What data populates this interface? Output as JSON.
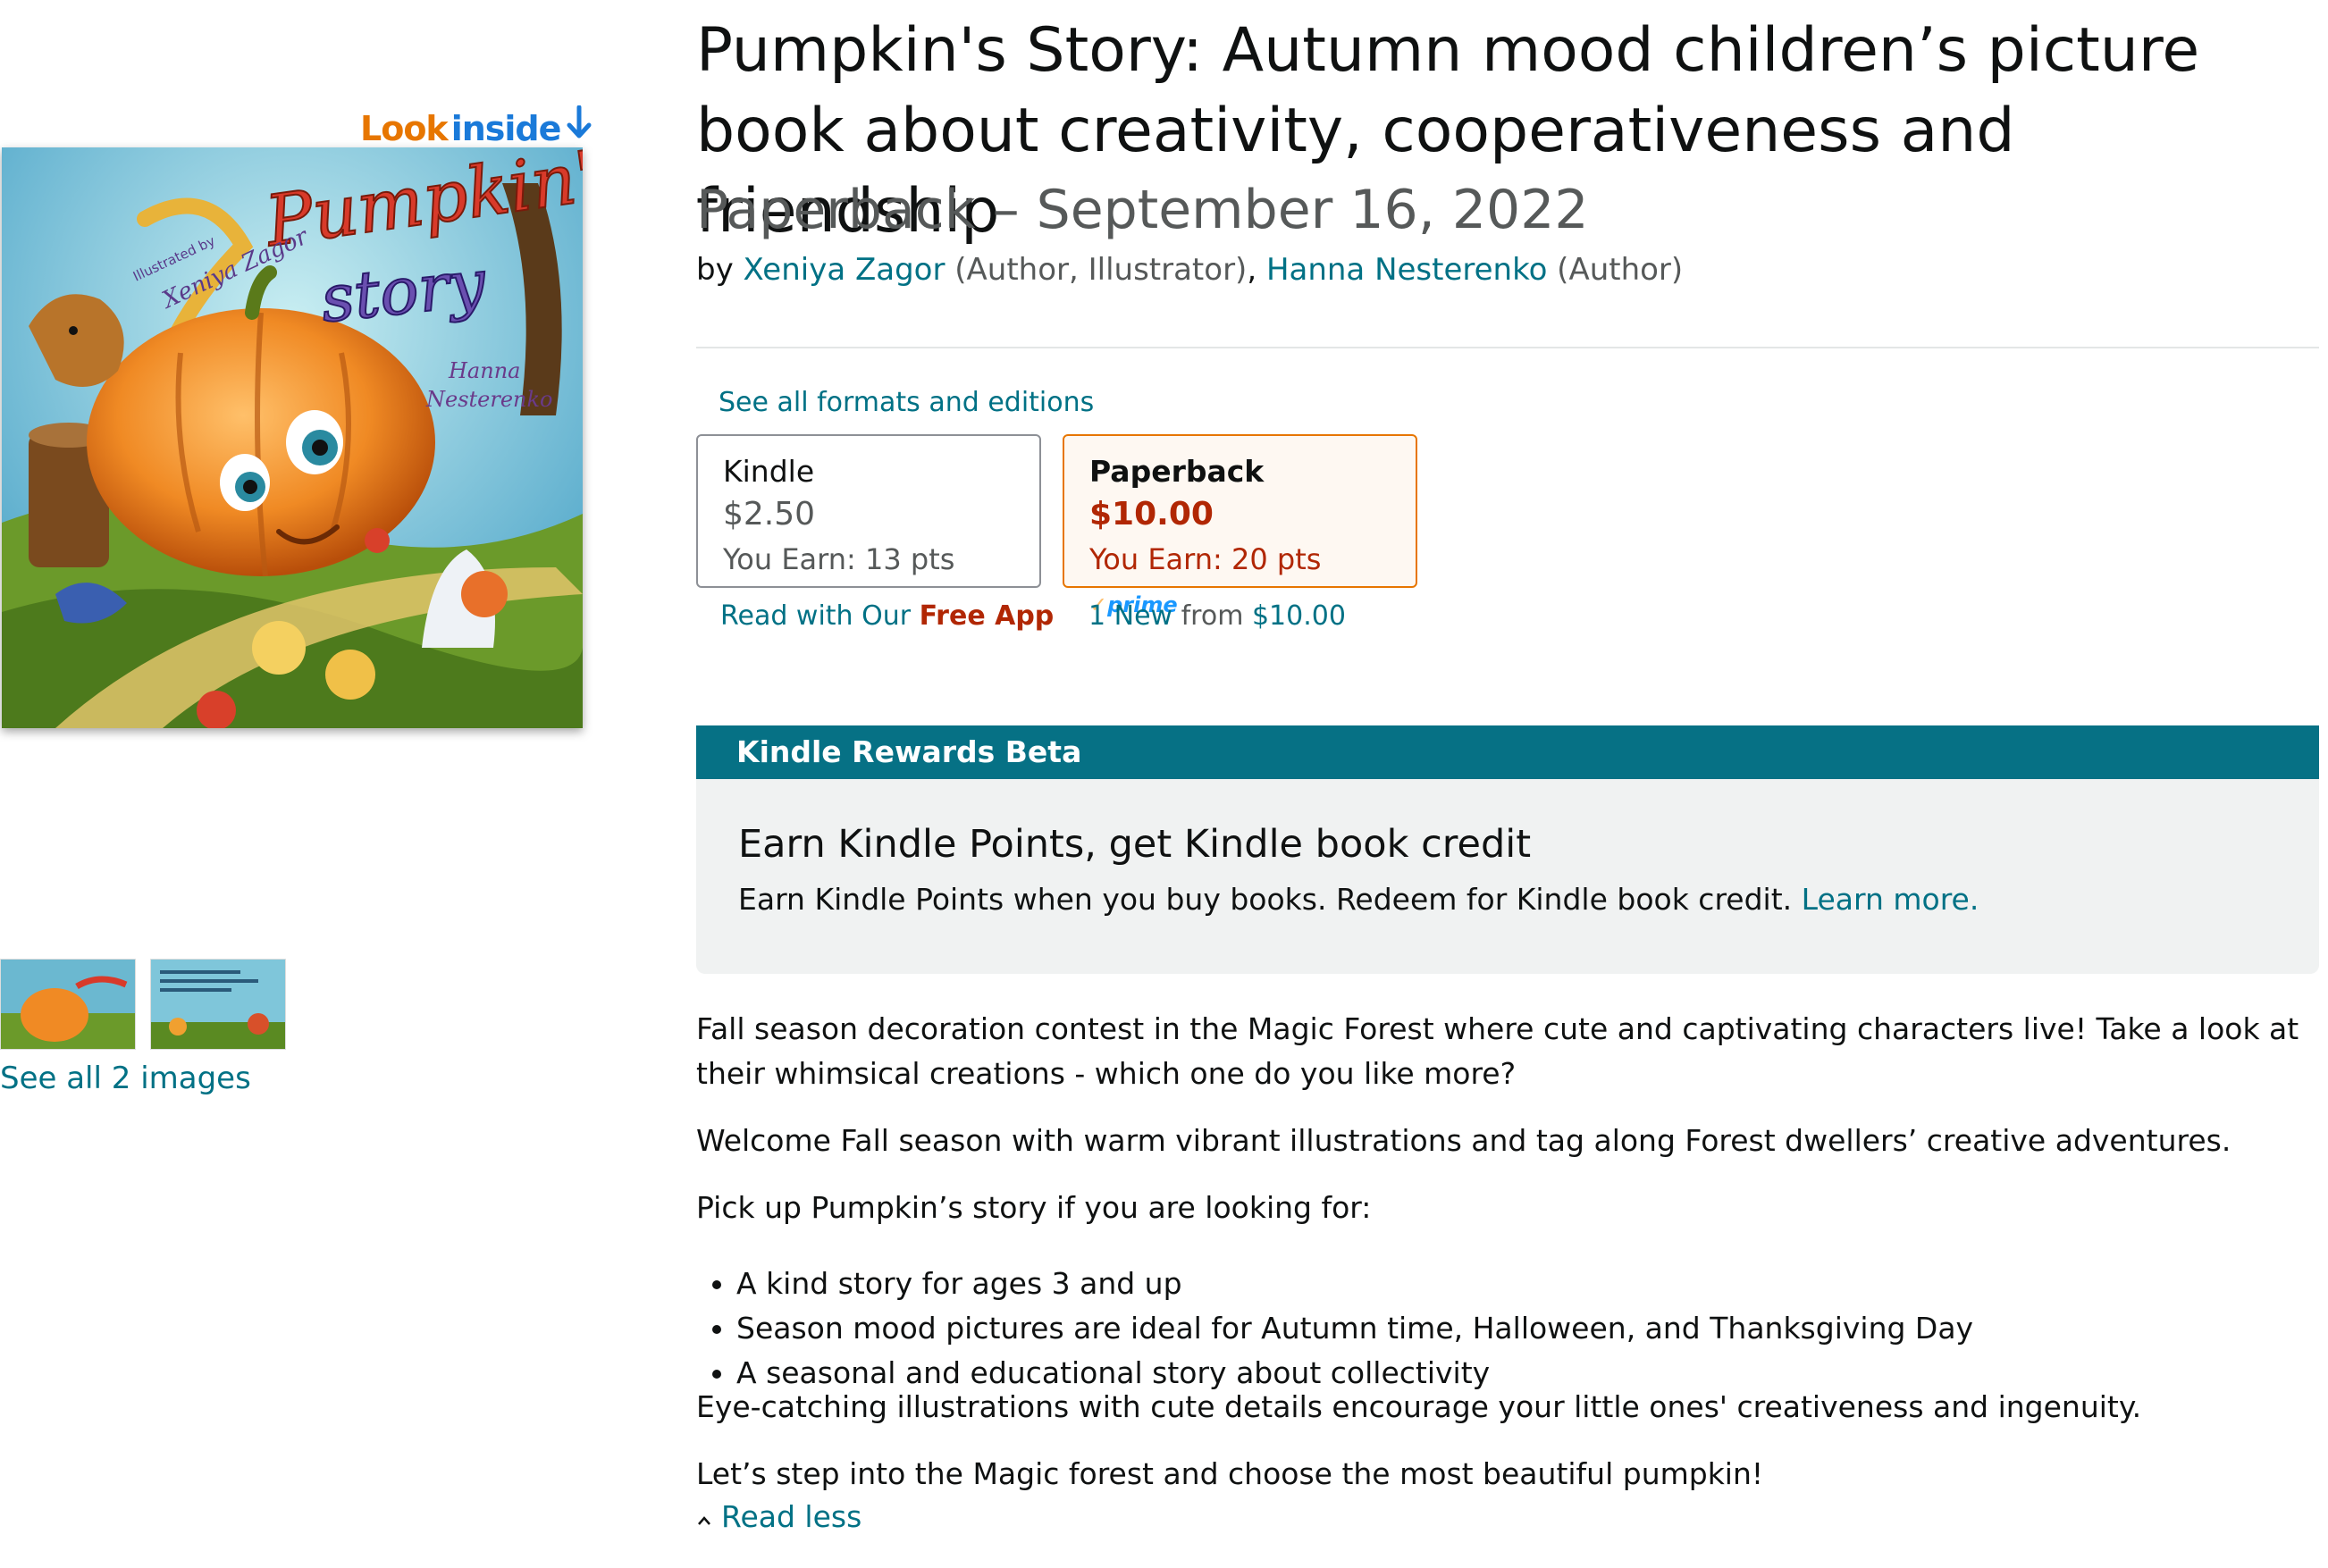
{
  "product": {
    "title": "Pumpkin's Story: Autumn mood children’s picture book about creativity, cooperativeness and friendship",
    "format_date": "Paperback – September 16, 2022",
    "by_label": "by",
    "authors": [
      {
        "name": "Xeniya Zagor",
        "role": " (Author, Illustrator)"
      },
      {
        "name": "Hanna Nesterenko",
        "role": " (Author)"
      }
    ],
    "author_separator": ", "
  },
  "images": {
    "look_inside_1": "Look",
    "look_inside_2": "inside",
    "see_all": "See all 2 images",
    "cover_text": {
      "title_1": "Pumpkin's",
      "title_2": "story",
      "illustrated_by": "Illustrated by",
      "illustrator": "Xeniya Zagor",
      "author_1": "Hanna",
      "author_2": "Nesterenko"
    }
  },
  "formats": {
    "see_all": "See all formats and editions",
    "kindle": {
      "name": "Kindle",
      "price": "$2.50",
      "earn": "You Earn: 13 pts"
    },
    "paperback": {
      "name": "Paperback",
      "price": "$10.00",
      "earn": "You Earn: 20 pts",
      "prime": "prime"
    },
    "read_with": "Read with Our ",
    "free_app": "Free App",
    "new_count": "1 New",
    "new_from": " from ",
    "new_price": "$10.00"
  },
  "rewards": {
    "header": "Kindle Rewards Beta",
    "title": "Earn Kindle Points, get Kindle book credit",
    "desc": "Earn Kindle Points when you buy books. Redeem for Kindle book credit.",
    "learn_more": "Learn more."
  },
  "description": {
    "p1": "Fall season decoration contest in the Magic Forest where cute and captivating characters live! Take a look at their whimsical creations - which one do you like more?",
    "p2": "Welcome Fall season with warm vibrant illustrations and tag along Forest dwellers’ creative adventures.",
    "p3": "Pick up Pumpkin’s story if you are looking for:",
    "bullets": [
      "A kind story for ages 3 and up",
      "Season mood pictures are ideal for Autumn time, Halloween, and Thanksgiving Day",
      "A seasonal and educational story about collectivity"
    ],
    "p4": "Eye-catching illustrations with cute details encourage your little ones' creativeness and ingenuity.",
    "p5": "Let’s step into the Magic forest and choose the most beautiful pumpkin!",
    "read_less": "Read less"
  },
  "colors": {
    "link": "#007185",
    "price": "#b12704",
    "accent_orange": "#e77600",
    "rewards_header": "#067185"
  }
}
